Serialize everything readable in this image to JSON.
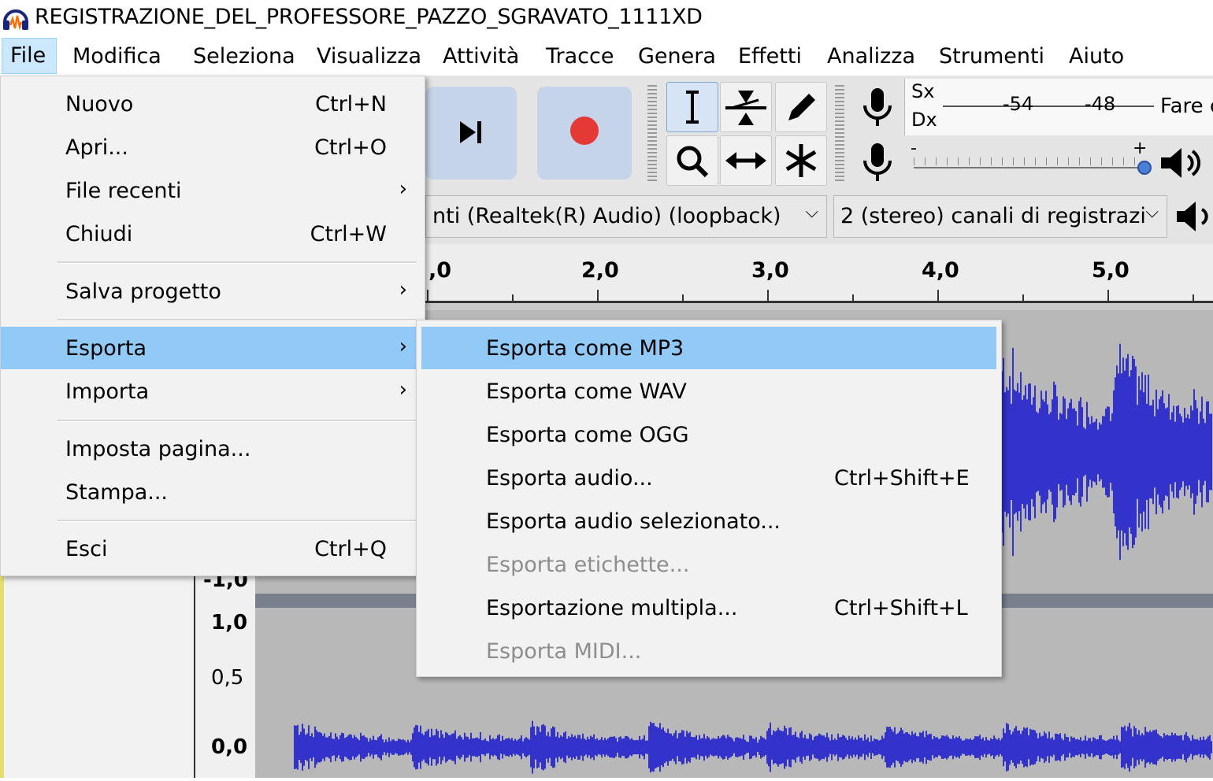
{
  "window": {
    "title": "REGISTRAZIONE_DEL_PROFESSORE_PAZZO_SGRAVATO_1111XD"
  },
  "menubar": [
    {
      "label": "File"
    },
    {
      "label": "Modifica"
    },
    {
      "label": "Seleziona"
    },
    {
      "label": "Visualizza"
    },
    {
      "label": "Attività"
    },
    {
      "label": "Tracce"
    },
    {
      "label": "Genera"
    },
    {
      "label": "Effetti"
    },
    {
      "label": "Analizza"
    },
    {
      "label": "Strumenti"
    },
    {
      "label": "Aiuto"
    }
  ],
  "file_menu": [
    {
      "label": "Nuovo",
      "shortcut": "Ctrl+N"
    },
    {
      "label": "Apri...",
      "shortcut": "Ctrl+O"
    },
    {
      "label": "File recenti",
      "arrow": "›"
    },
    {
      "label": "Chiudi",
      "shortcut": "Ctrl+W"
    },
    {
      "label": "Salva progetto",
      "arrow": "›"
    },
    {
      "label": "Esporta",
      "arrow": "›"
    },
    {
      "label": "Importa",
      "arrow": "›"
    },
    {
      "label": "Imposta pagina..."
    },
    {
      "label": "Stampa..."
    },
    {
      "label": "Esci",
      "shortcut": "Ctrl+Q"
    }
  ],
  "export_submenu": [
    {
      "label": "Esporta come MP3"
    },
    {
      "label": "Esporta come WAV"
    },
    {
      "label": "Esporta come OGG"
    },
    {
      "label": "Esporta audio...",
      "shortcut": "Ctrl+Shift+E"
    },
    {
      "label": "Esporta audio selezionato..."
    },
    {
      "label": "Esporta etichette..."
    },
    {
      "label": "Esportazione multipla...",
      "shortcut": "Ctrl+Shift+L"
    },
    {
      "label": "Esporta MIDI..."
    }
  ],
  "meters": {
    "left_label": "Sx",
    "right_label": "Dx",
    "scale": [
      "-54",
      "-48"
    ],
    "start_text": "Fare c",
    "minus": "-",
    "plus": "+"
  },
  "devices": {
    "playback_device": "nti (Realtek(R) Audio) (loopback)",
    "recording_channels": "2 (stereo) canali di registrazi"
  },
  "ruler": {
    "labels": [
      ",0",
      "2,0",
      "3,0",
      "4,0",
      "5,0"
    ]
  },
  "track_scale": {
    "labels": [
      "-1,0",
      "1,0",
      "0,5",
      "0,0"
    ]
  },
  "colors": {
    "menu_highlight": "#91c9f7",
    "waveform": "#3333cc",
    "record": "#e53935"
  }
}
